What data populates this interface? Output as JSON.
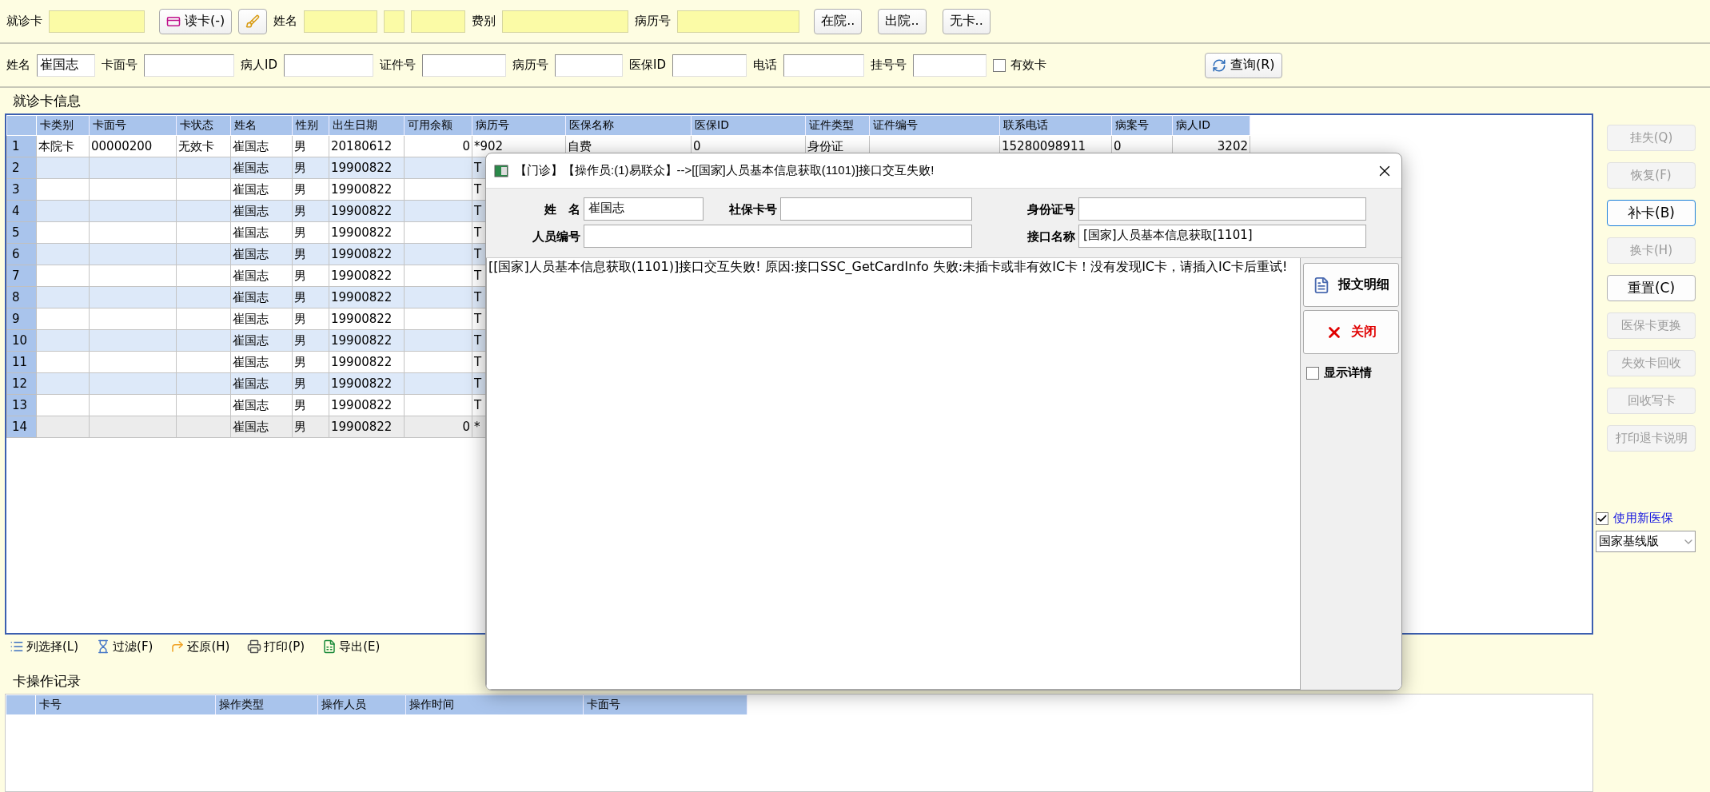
{
  "search_row_1": [
    {
      "kind": "label",
      "text": "就诊卡"
    },
    {
      "kind": "field"
    },
    {
      "kind": "card_button",
      "text": "读卡(-)"
    },
    {
      "kind": "broom_button"
    },
    {
      "kind": "label",
      "text": "姓名"
    },
    {
      "kind": "field"
    },
    {
      "kind": "field"
    },
    {
      "kind": "field"
    },
    {
      "kind": "label",
      "text": "费别"
    },
    {
      "kind": "field"
    },
    {
      "kind": "label",
      "text": "病历号"
    },
    {
      "kind": "field"
    },
    {
      "kind": "button",
      "text": "在院.."
    },
    {
      "kind": "button",
      "text": "出院.."
    },
    {
      "kind": "button",
      "text": "无卡.."
    }
  ],
  "search_row_2": [
    {
      "kind": "label",
      "text": "姓名"
    },
    {
      "kind": "field",
      "value": "崔国志"
    },
    {
      "kind": "label",
      "text": "卡面号"
    },
    {
      "kind": "field"
    },
    {
      "kind": "label",
      "text": "病人ID"
    },
    {
      "kind": "field"
    },
    {
      "kind": "label",
      "text": "证件号"
    },
    {
      "kind": "field"
    },
    {
      "kind": "label",
      "text": "病历号"
    },
    {
      "kind": "field"
    },
    {
      "kind": "label",
      "text": "医保ID"
    },
    {
      "kind": "field"
    },
    {
      "kind": "label",
      "text": "电话"
    },
    {
      "kind": "field"
    },
    {
      "kind": "label",
      "text": "挂号号"
    },
    {
      "kind": "field"
    },
    {
      "kind": "checkbox",
      "text": "有效卡",
      "checked": false
    }
  ],
  "query_button": "查询(R)",
  "card_group": {
    "title": "就诊卡信息",
    "columns": [
      "卡类别",
      "卡面号",
      "卡状态",
      "姓名",
      "性别",
      "出生日期",
      "可用余额",
      "病历号",
      "医保名称",
      "医保ID",
      "证件类型",
      "证件编号",
      "联系电话",
      "病案号",
      "病人ID"
    ],
    "rows": [
      {
        "no": "1",
        "selected": false,
        "cells": {
          "card_type": "本院卡",
          "card_no": "00000200",
          "card_status": "无效卡",
          "name": "崔国志",
          "sex": "男",
          "birth_date": "20180612",
          "balance": "0",
          "record_no": "*902",
          "insurance_name": "自费",
          "insurance_id": "0",
          "id_type": "身份证",
          "phone": "15280098911",
          "case_no": "0",
          "patient_id": "3202"
        }
      },
      {
        "no": "2",
        "selected": false,
        "cells": {
          "name": "崔国志",
          "sex": "男",
          "birth_date": "19900822",
          "record_no": "T"
        }
      },
      {
        "no": "3",
        "selected": false,
        "cells": {
          "name": "崔国志",
          "sex": "男",
          "birth_date": "19900822",
          "record_no": "T"
        }
      },
      {
        "no": "4",
        "selected": false,
        "cells": {
          "name": "崔国志",
          "sex": "男",
          "birth_date": "19900822",
          "record_no": "T"
        }
      },
      {
        "no": "5",
        "selected": false,
        "cells": {
          "name": "崔国志",
          "sex": "男",
          "birth_date": "19900822",
          "record_no": "T"
        }
      },
      {
        "no": "6",
        "selected": false,
        "cells": {
          "name": "崔国志",
          "sex": "男",
          "birth_date": "19900822",
          "record_no": "T"
        }
      },
      {
        "no": "7",
        "selected": false,
        "cells": {
          "name": "崔国志",
          "sex": "男",
          "birth_date": "19900822",
          "record_no": "T"
        }
      },
      {
        "no": "8",
        "selected": false,
        "cells": {
          "name": "崔国志",
          "sex": "男",
          "birth_date": "19900822",
          "record_no": "T"
        }
      },
      {
        "no": "9",
        "selected": false,
        "cells": {
          "name": "崔国志",
          "sex": "男",
          "birth_date": "19900822",
          "record_no": "T"
        }
      },
      {
        "no": "10",
        "selected": false,
        "cells": {
          "name": "崔国志",
          "sex": "男",
          "birth_date": "19900822",
          "record_no": "T"
        }
      },
      {
        "no": "11",
        "selected": false,
        "cells": {
          "name": "崔国志",
          "sex": "男",
          "birth_date": "19900822",
          "record_no": "T"
        }
      },
      {
        "no": "12",
        "selected": false,
        "cells": {
          "name": "崔国志",
          "sex": "男",
          "birth_date": "19900822",
          "record_no": "T"
        }
      },
      {
        "no": "13",
        "selected": false,
        "cells": {
          "name": "崔国志",
          "sex": "男",
          "birth_date": "19900822",
          "record_no": "T"
        }
      },
      {
        "no": "14",
        "selected": true,
        "cells": {
          "name": "崔国志",
          "sex": "男",
          "birth_date": "19900822",
          "balance": "0",
          "record_no": "*"
        }
      }
    ]
  },
  "table_toolbar": [
    {
      "kind": "columns",
      "text": "列选择(L)"
    },
    {
      "kind": "filter",
      "text": "过滤(F)"
    },
    {
      "kind": "restore",
      "text": "还原(H)"
    },
    {
      "kind": "print",
      "text": "打印(P)"
    },
    {
      "kind": "export",
      "text": "导出(E)"
    }
  ],
  "log_group": {
    "title": "卡操作记录",
    "columns": [
      "卡号",
      "操作类型",
      "操作人员",
      "操作时间",
      "卡面号"
    ]
  },
  "side_buttons": [
    {
      "text": "挂失(Q)",
      "disabled": true,
      "focused": false
    },
    {
      "text": "恢复(F)",
      "disabled": true,
      "focused": false
    },
    {
      "text": "补卡(B)",
      "disabled": false,
      "focused": true
    },
    {
      "text": "换卡(H)",
      "disabled": true,
      "focused": false
    },
    {
      "text": "重置(C)",
      "disabled": false,
      "focused": false
    },
    {
      "text": "医保卡更换",
      "disabled": true,
      "focused": false
    },
    {
      "text": "失效卡回收",
      "disabled": true,
      "focused": false
    },
    {
      "text": "回收写卡",
      "disabled": true,
      "focused": false
    },
    {
      "text": "打印退卡说明",
      "disabled": true,
      "focused": false
    }
  ],
  "new_insurance": {
    "text": "使用新医保",
    "checked": true
  },
  "version_select": {
    "value": "国家基线版"
  },
  "dialog": {
    "title": "【门诊】【操作员:(1)易联众】-->[[国家]人员基本信息获取(1101)]接口交互失败!",
    "fields": [
      {
        "label": "姓　名",
        "value": "崔国志"
      },
      {
        "label": "社保卡号"
      },
      {
        "label": "身份证号"
      },
      {
        "label": "人员编号"
      },
      {
        "label": "接口名称",
        "value": "[国家]人员基本信息获取[1101]"
      }
    ],
    "message": "[[国家]人员基本信息获取(1101)]接口交互失败! 原因:接口SSC_GetCardInfo 失败:未插卡或非有效IC卡！没有发现IC卡，请插入IC卡后重试!",
    "detail_button": "报文明细",
    "close_button": "关闭",
    "show_details": {
      "text": "显示详情",
      "checked": false
    }
  }
}
